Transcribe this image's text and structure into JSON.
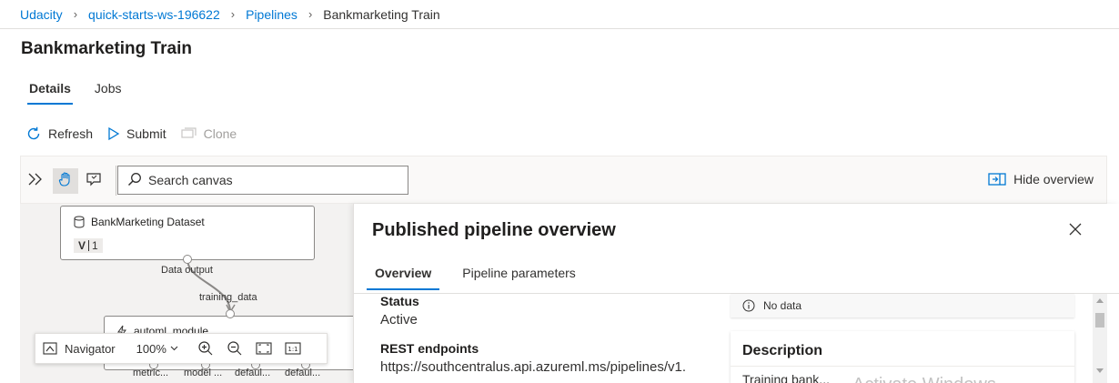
{
  "breadcrumb": {
    "items": [
      "Udacity",
      "quick-starts-ws-196622",
      "Pipelines"
    ],
    "current": "Bankmarketing Train"
  },
  "page": {
    "title": "Bankmarketing Train"
  },
  "tabs": [
    {
      "label": "Details",
      "active": true
    },
    {
      "label": "Jobs",
      "active": false
    }
  ],
  "commands": {
    "refresh": "Refresh",
    "submit": "Submit",
    "clone": "Clone"
  },
  "canvas_toolbar": {
    "search_placeholder": "Search canvas",
    "hide_overview": "Hide overview"
  },
  "graph": {
    "dataset_node": {
      "title": "BankMarketing Dataset",
      "badge_letter": "V",
      "badge_version": "1",
      "output_port": "Data output"
    },
    "automl_node": {
      "title": "automl_module",
      "input_port": "training_data",
      "output_ports": [
        "metric...",
        "model ...",
        "defaul...",
        "defaul..."
      ]
    }
  },
  "navigator": {
    "label": "Navigator",
    "zoom": "100%"
  },
  "overview_panel": {
    "title": "Published pipeline overview",
    "tabs": [
      {
        "label": "Overview",
        "active": true
      },
      {
        "label": "Pipeline parameters",
        "active": false
      }
    ],
    "status_label": "Status",
    "status_value": "Active",
    "rest_label": "REST endpoints",
    "rest_value": "https://southcentralus.api.azureml.ms/pipelines/v1.",
    "no_data": "No data",
    "description_title": "Description",
    "description_text": "Training bank..."
  },
  "watermark": "Activate Windows",
  "colors": {
    "accent": "#0078d4",
    "text": "#323130",
    "canvas_bg": "#f3f2f1"
  },
  "icons": [
    "chevron-right-icon",
    "refresh-icon",
    "play-icon",
    "clone-icon",
    "expand-icon",
    "hand-icon",
    "comment-icon",
    "search-icon",
    "hide-overview-icon",
    "database-icon",
    "lightning-icon",
    "navigator-icon",
    "zoom-in-icon",
    "zoom-out-icon",
    "fit-screen-icon",
    "actual-size-icon",
    "close-icon",
    "info-icon"
  ]
}
